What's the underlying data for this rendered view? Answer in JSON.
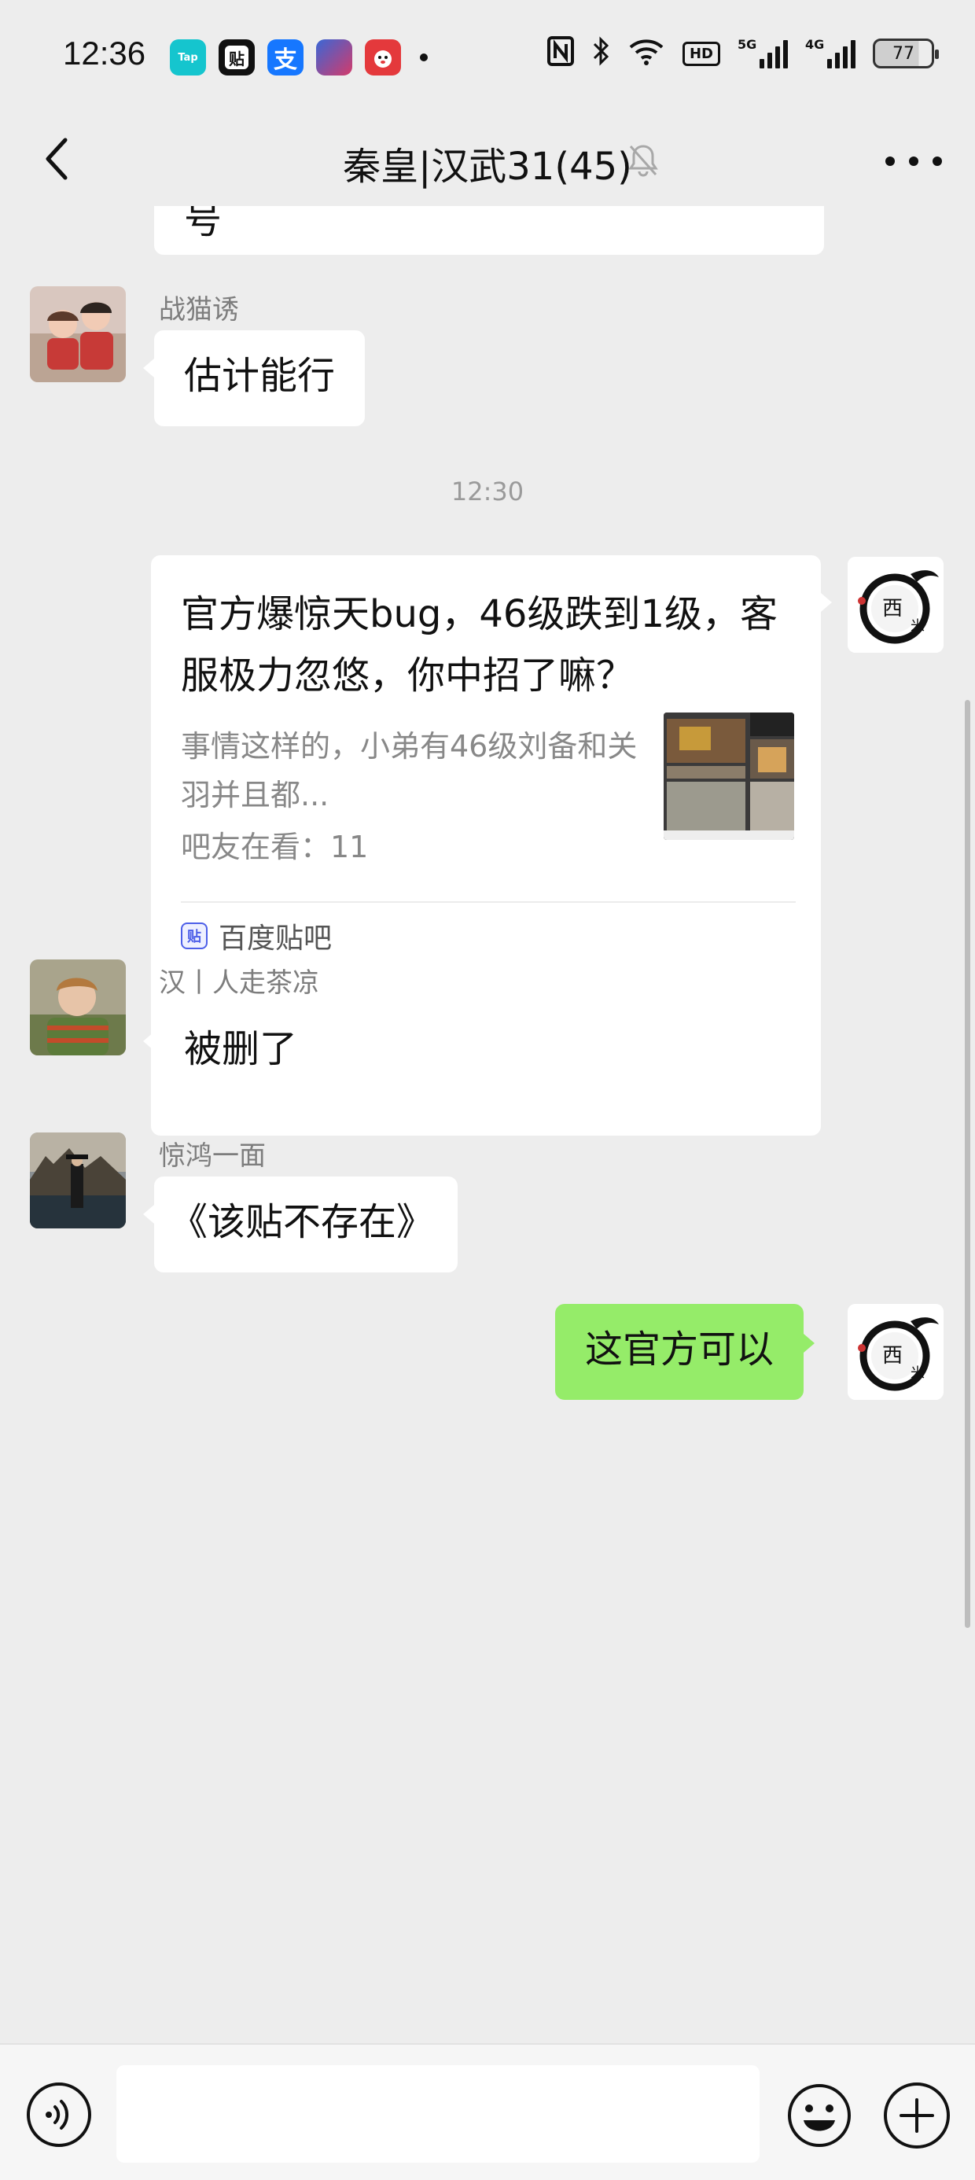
{
  "status_bar": {
    "time": "12:36",
    "app_icons": [
      "taptap-icon",
      "tieba-icon",
      "alipay-icon",
      "game-icon",
      "jd-icon"
    ],
    "taptap_text": "Tap",
    "tieba_text": "贴",
    "alipay_text": "支",
    "hd_text": "HD",
    "signal_1_tag": "5G",
    "signal_2_tag": "4G",
    "battery": "77"
  },
  "header": {
    "title": "秦皇|汉武31(45)"
  },
  "messages": [
    {
      "sender": "",
      "text": "号",
      "side": "left"
    },
    {
      "sender": "战猫诱",
      "text": "估计能行",
      "side": "left"
    },
    {
      "timestamp": "12:30"
    },
    {
      "type": "link_card",
      "side": "right",
      "title": "官方爆惊天bug，46级跌到1级，客服极力忽悠，你中招了嘛？",
      "description": "事情这样的，小弟有46级刘备和关羽并且都...",
      "meta": "吧友在看：11",
      "source": "百度贴吧",
      "source_icon_text": "贴"
    },
    {
      "sender": "汉丨人走茶凉",
      "text": "被删了",
      "side": "left"
    },
    {
      "sender": "惊鸿一面",
      "text": "《该贴不存在》",
      "side": "left"
    },
    {
      "sender": "",
      "text": "这官方可以",
      "side": "right"
    }
  ],
  "self_avatar_text": "西米",
  "input": {
    "placeholder": ""
  },
  "colors": {
    "background": "#ededed",
    "bubble_self": "#95ec69",
    "bubble_other": "#ffffff"
  }
}
